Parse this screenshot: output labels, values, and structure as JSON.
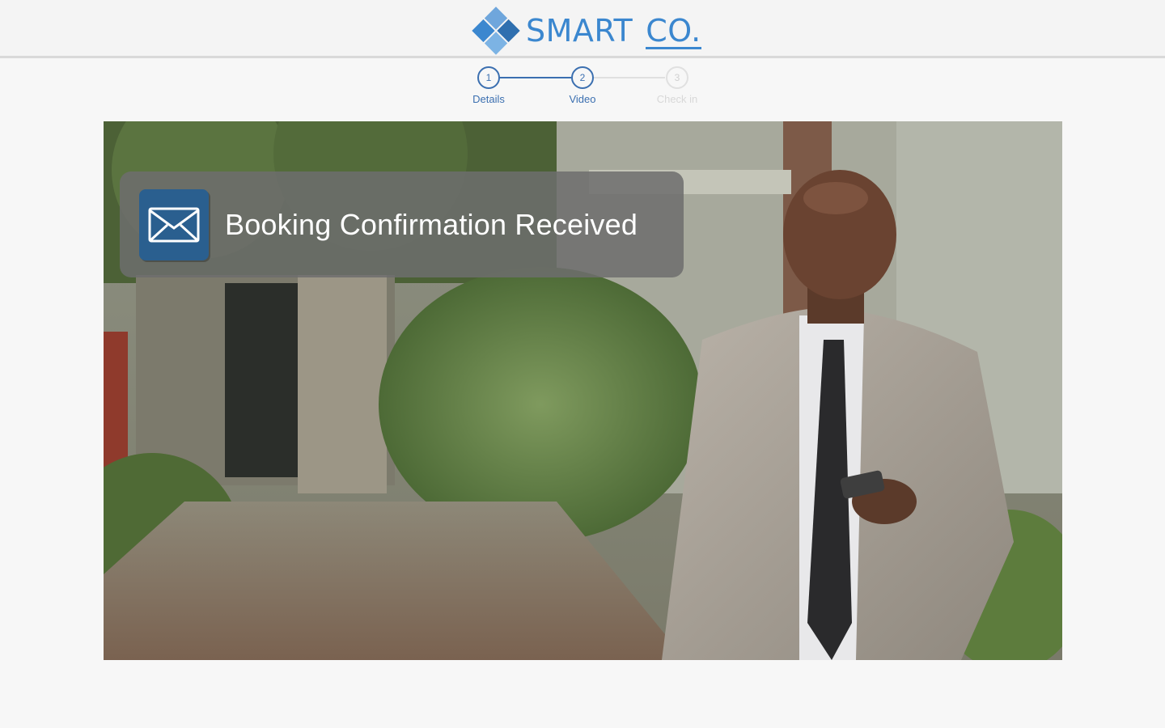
{
  "brand": {
    "name": "SMART",
    "suffix": "CO.",
    "color": "#3b87cf",
    "icon": "diamond-grid-logo"
  },
  "stepper": {
    "active_color": "#3b6fb0",
    "inactive_color": "#e0e0e0",
    "steps": [
      {
        "number": "1",
        "label": "Details",
        "state": "complete"
      },
      {
        "number": "2",
        "label": "Video",
        "state": "current"
      },
      {
        "number": "3",
        "label": "Check in",
        "state": "pending"
      }
    ]
  },
  "video": {
    "notification": {
      "icon": "envelope-icon",
      "text": "Booking Confirmation Received"
    }
  }
}
